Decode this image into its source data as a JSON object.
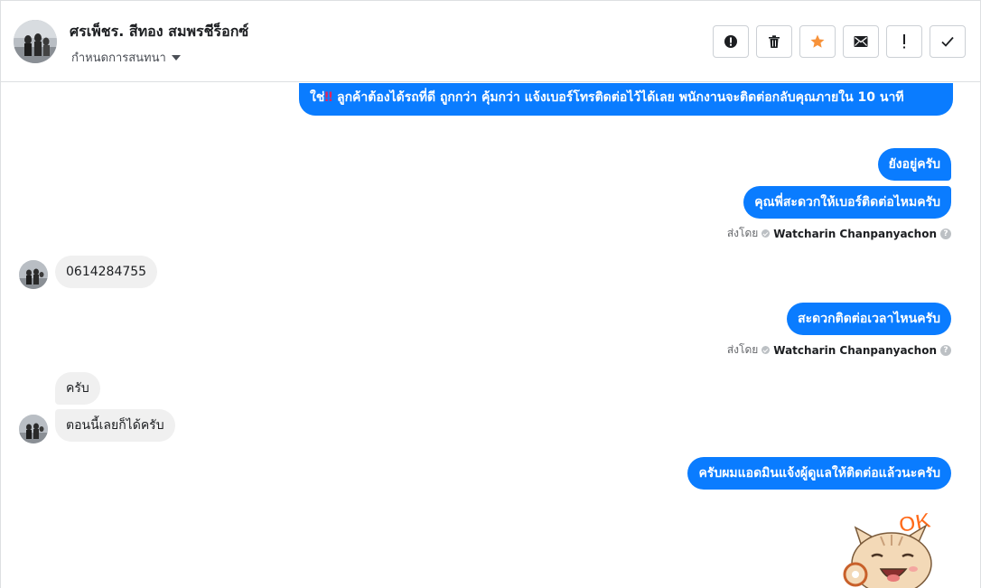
{
  "header": {
    "contact_name": "ศรเพ็ชร. สีทอง สมพรชีร็อกซ์",
    "assign_label": "กำหนดการสนทนา",
    "toolbar": {
      "spam_icon": "alert-circle-icon",
      "delete_icon": "trash-icon",
      "star_icon": "star-icon",
      "mail_icon": "envelope-icon",
      "follow_up_icon": "exclamation-icon",
      "done_icon": "check-icon",
      "star_color": "#f7923a"
    }
  },
  "messages": {
    "m1_text": "ใช่",
    "m1_bang": "‼",
    "m1_rest": " ลูกค้าต้องได้รถที่ดี ถูกกว่า คุ้มกว่า แจ้งเบอร์โทรติดต่อไว้ได้เลย พนักงานจะติดต่อกลับคุณภายใน 10 นาที",
    "m2": "ยังอยู่ครับ",
    "m3": "คุณพี่สะดวกให้เบอร์ติดต่อไหมครับ",
    "m4_in": "0614284755",
    "m5": "สะดวกติดต่อเวลาไหนครับ",
    "m6_in": "ครับ",
    "m7_in": "ตอนนี้เลยก็ได้ครับ",
    "m8": "ครับผมแอดมินแจ้งผู้ดูแลให้ติดต่อแล้วนะครับ",
    "sticker_text": "OK"
  },
  "sender_info": {
    "sent_by": "ส่งโดย",
    "agent_name": "Watcharin Chanpanyachon",
    "help": "?"
  },
  "colors": {
    "outgoing_bubble": "#0a7cff",
    "incoming_bubble": "#f0f0f0"
  }
}
